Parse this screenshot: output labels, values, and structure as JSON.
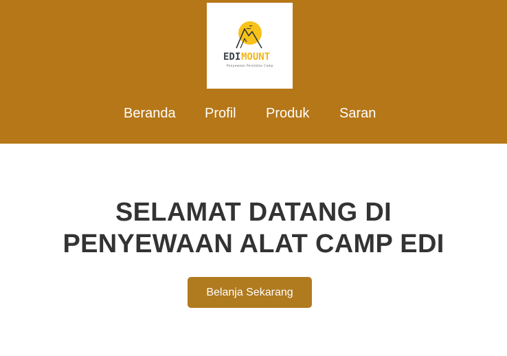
{
  "brand": {
    "logo_text_dark": "EDI",
    "logo_text_accent": "MOUNT",
    "logo_tagline": "Penyewaan Peralatan Camp",
    "logo_icon": "mountain-sun-icon",
    "colors": {
      "header_bg": "#b67718",
      "logo_dark": "#3a4145",
      "logo_accent": "#f3b516",
      "sun": "#f7c21a"
    }
  },
  "nav": {
    "items": [
      {
        "label": "Beranda"
      },
      {
        "label": "Profil"
      },
      {
        "label": "Produk"
      },
      {
        "label": "Saran"
      }
    ]
  },
  "hero": {
    "title_line1": "SELAMAT DATANG DI",
    "title_line2": "PENYEWAAN ALAT CAMP EDI",
    "cta_label": "Belanja Sekarang",
    "cta_color": "#b07a1f"
  }
}
